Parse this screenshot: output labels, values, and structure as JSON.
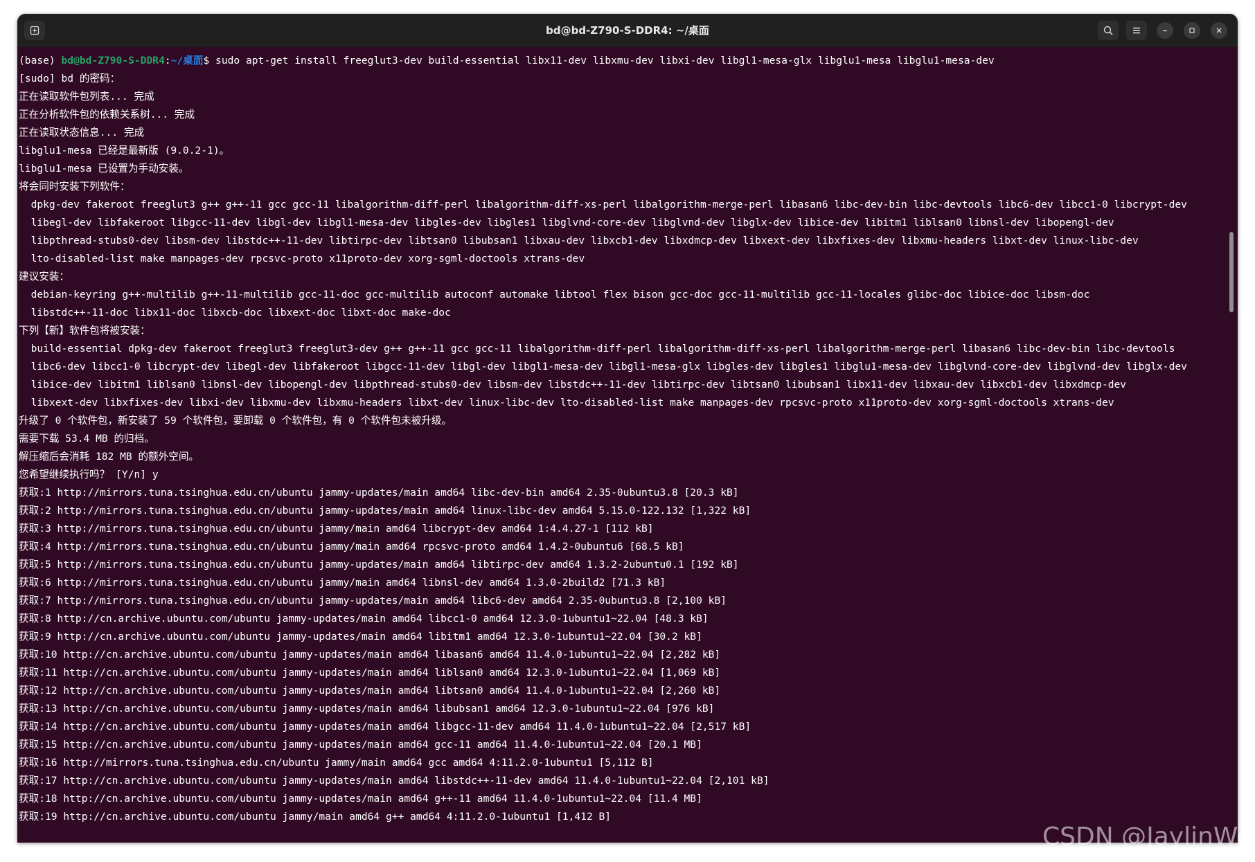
{
  "window": {
    "title": "bd@bd-Z790-S-DDR4: ~/桌面",
    "icons": {
      "new_tab": "new-tab-icon",
      "search": "search-icon",
      "menu": "hamburger-menu-icon",
      "minimize": "minimize-icon",
      "maximize": "maximize-icon",
      "close": "close-icon"
    }
  },
  "prompt": {
    "env": "(base) ",
    "user_host": "bd@bd-Z790-S-DDR4",
    "sep": ":",
    "path": "~/桌面",
    "dollar": "$ ",
    "command": "sudo apt-get install freeglut3-dev build-essential libx11-dev libxmu-dev libxi-dev libgl1-mesa-glx libglu1-mesa libglu1-mesa-dev"
  },
  "lines": [
    "[sudo] bd 的密码：",
    "正在读取软件包列表... 完成",
    "正在分析软件包的依赖关系树... 完成",
    "正在读取状态信息... 完成",
    "libglu1-mesa 已经是最新版 (9.0.2-1)。",
    "libglu1-mesa 已设置为手动安装。",
    "将会同时安装下列软件：",
    "  dpkg-dev fakeroot freeglut3 g++ g++-11 gcc gcc-11 libalgorithm-diff-perl libalgorithm-diff-xs-perl libalgorithm-merge-perl libasan6 libc-dev-bin libc-devtools libc6-dev libcc1-0 libcrypt-dev",
    "  libegl-dev libfakeroot libgcc-11-dev libgl-dev libgl1-mesa-dev libgles-dev libgles1 libglvnd-core-dev libglvnd-dev libglx-dev libice-dev libitm1 liblsan0 libnsl-dev libopengl-dev",
    "  libpthread-stubs0-dev libsm-dev libstdc++-11-dev libtirpc-dev libtsan0 libubsan1 libxau-dev libxcb1-dev libxdmcp-dev libxext-dev libxfixes-dev libxmu-headers libxt-dev linux-libc-dev",
    "  lto-disabled-list make manpages-dev rpcsvc-proto x11proto-dev xorg-sgml-doctools xtrans-dev",
    "建议安装：",
    "  debian-keyring g++-multilib g++-11-multilib gcc-11-doc gcc-multilib autoconf automake libtool flex bison gcc-doc gcc-11-multilib gcc-11-locales glibc-doc libice-doc libsm-doc",
    "  libstdc++-11-doc libx11-doc libxcb-doc libxext-doc libxt-doc make-doc",
    "下列【新】软件包将被安装：",
    "  build-essential dpkg-dev fakeroot freeglut3 freeglut3-dev g++ g++-11 gcc gcc-11 libalgorithm-diff-perl libalgorithm-diff-xs-perl libalgorithm-merge-perl libasan6 libc-dev-bin libc-devtools",
    "  libc6-dev libcc1-0 libcrypt-dev libegl-dev libfakeroot libgcc-11-dev libgl-dev libgl1-mesa-dev libgl1-mesa-glx libgles-dev libgles1 libglu1-mesa-dev libglvnd-core-dev libglvnd-dev libglx-dev",
    "  libice-dev libitm1 liblsan0 libnsl-dev libopengl-dev libpthread-stubs0-dev libsm-dev libstdc++-11-dev libtirpc-dev libtsan0 libubsan1 libx11-dev libxau-dev libxcb1-dev libxdmcp-dev",
    "  libxext-dev libxfixes-dev libxi-dev libxmu-dev libxmu-headers libxt-dev linux-libc-dev lto-disabled-list make manpages-dev rpcsvc-proto x11proto-dev xorg-sgml-doctools xtrans-dev",
    "升级了 0 个软件包，新安装了 59 个软件包，要卸载 0 个软件包，有 0 个软件包未被升级。",
    "需要下载 53.4 MB 的归档。",
    "解压缩后会消耗 182 MB 的额外空间。",
    "您希望继续执行吗？ [Y/n] y",
    "获取:1 http://mirrors.tuna.tsinghua.edu.cn/ubuntu jammy-updates/main amd64 libc-dev-bin amd64 2.35-0ubuntu3.8 [20.3 kB]",
    "获取:2 http://mirrors.tuna.tsinghua.edu.cn/ubuntu jammy-updates/main amd64 linux-libc-dev amd64 5.15.0-122.132 [1,322 kB]",
    "获取:3 http://mirrors.tuna.tsinghua.edu.cn/ubuntu jammy/main amd64 libcrypt-dev amd64 1:4.4.27-1 [112 kB]",
    "获取:4 http://mirrors.tuna.tsinghua.edu.cn/ubuntu jammy/main amd64 rpcsvc-proto amd64 1.4.2-0ubuntu6 [68.5 kB]",
    "获取:5 http://mirrors.tuna.tsinghua.edu.cn/ubuntu jammy-updates/main amd64 libtirpc-dev amd64 1.3.2-2ubuntu0.1 [192 kB]",
    "获取:6 http://mirrors.tuna.tsinghua.edu.cn/ubuntu jammy/main amd64 libnsl-dev amd64 1.3.0-2build2 [71.3 kB]",
    "获取:7 http://mirrors.tuna.tsinghua.edu.cn/ubuntu jammy-updates/main amd64 libc6-dev amd64 2.35-0ubuntu3.8 [2,100 kB]",
    "获取:8 http://cn.archive.ubuntu.com/ubuntu jammy-updates/main amd64 libcc1-0 amd64 12.3.0-1ubuntu1~22.04 [48.3 kB]",
    "获取:9 http://cn.archive.ubuntu.com/ubuntu jammy-updates/main amd64 libitm1 amd64 12.3.0-1ubuntu1~22.04 [30.2 kB]",
    "获取:10 http://cn.archive.ubuntu.com/ubuntu jammy-updates/main amd64 libasan6 amd64 11.4.0-1ubuntu1~22.04 [2,282 kB]",
    "获取:11 http://cn.archive.ubuntu.com/ubuntu jammy-updates/main amd64 liblsan0 amd64 12.3.0-1ubuntu1~22.04 [1,069 kB]",
    "获取:12 http://cn.archive.ubuntu.com/ubuntu jammy-updates/main amd64 libtsan0 amd64 11.4.0-1ubuntu1~22.04 [2,260 kB]",
    "获取:13 http://cn.archive.ubuntu.com/ubuntu jammy-updates/main amd64 libubsan1 amd64 12.3.0-1ubuntu1~22.04 [976 kB]",
    "获取:14 http://cn.archive.ubuntu.com/ubuntu jammy-updates/main amd64 libgcc-11-dev amd64 11.4.0-1ubuntu1~22.04 [2,517 kB]",
    "获取:15 http://cn.archive.ubuntu.com/ubuntu jammy-updates/main amd64 gcc-11 amd64 11.4.0-1ubuntu1~22.04 [20.1 MB]",
    "获取:16 http://mirrors.tuna.tsinghua.edu.cn/ubuntu jammy/main amd64 gcc amd64 4:11.2.0-1ubuntu1 [5,112 B]",
    "获取:17 http://cn.archive.ubuntu.com/ubuntu jammy-updates/main amd64 libstdc++-11-dev amd64 11.4.0-1ubuntu1~22.04 [2,101 kB]",
    "获取:18 http://cn.archive.ubuntu.com/ubuntu jammy-updates/main amd64 g++-11 amd64 11.4.0-1ubuntu1~22.04 [11.4 MB]",
    "获取:19 http://cn.archive.ubuntu.com/ubuntu jammy/main amd64 g++ amd64 4:11.2.0-1ubuntu1 [1,412 B]"
  ],
  "watermark": "CSDN @JaylinWong",
  "colors": {
    "terminal_bg": "#300a24",
    "titlebar_bg": "#202020",
    "prompt_user": "#26a269",
    "prompt_path": "#2a7bde",
    "text": "#ffffff"
  }
}
